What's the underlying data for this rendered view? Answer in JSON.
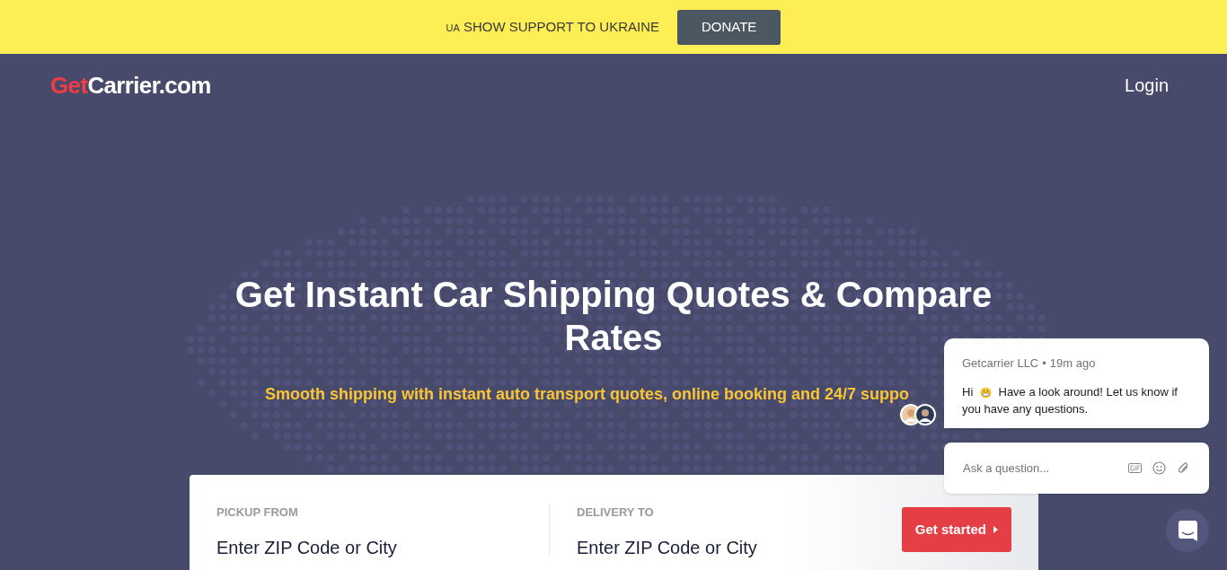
{
  "banner": {
    "flag": "UA",
    "text": "SHOW SUPPORT TO UKRAINE",
    "button": "DONATE"
  },
  "header": {
    "logo": {
      "part_1": "Get",
      "part_2": "Carrier.com"
    },
    "login": "Login"
  },
  "hero": {
    "title": "Get Instant Car Shipping Quotes & Compare Rates",
    "subtitle": "Smooth shipping with instant auto transport quotes, online booking and 24/7 suppo"
  },
  "quote_form": {
    "fields": [
      {
        "label": "PICKUP FROM",
        "placeholder": "Enter ZIP Code or City"
      },
      {
        "label": "DELIVERY TO",
        "placeholder": "Enter ZIP Code or City"
      }
    ],
    "button": "Get started"
  },
  "chat": {
    "sender": "Getcarrier LLC",
    "separator": "•",
    "time": "19m ago",
    "greeting": "Hi",
    "message": "Have a look around! Let us know if you have any questions.",
    "input_placeholder": "Ask a question..."
  }
}
